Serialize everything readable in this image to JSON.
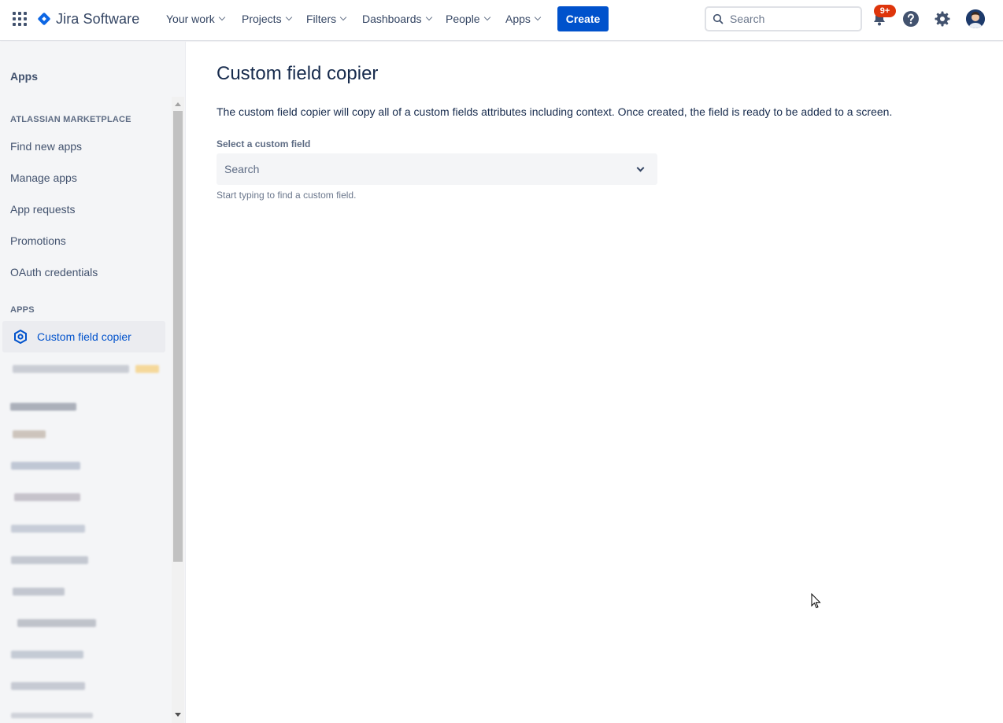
{
  "topnav": {
    "product_name": "Jira Software",
    "items": [
      "Your work",
      "Projects",
      "Filters",
      "Dashboards",
      "People",
      "Apps"
    ],
    "create_label": "Create",
    "search_placeholder": "Search",
    "notification_badge": "9+"
  },
  "sidebar": {
    "header": "Apps",
    "marketplace_section": "ATLASSIAN MARKETPLACE",
    "marketplace_items": [
      "Find new apps",
      "Manage apps",
      "App requests",
      "Promotions",
      "OAuth credentials"
    ],
    "apps_section": "APPS",
    "active_item": "Custom field copier"
  },
  "main": {
    "title": "Custom field copier",
    "description": "The custom field copier will copy all of a custom fields attributes including context. Once created, the field is ready to be added to a screen.",
    "field_label": "Select a custom field",
    "select_placeholder": "Search",
    "helper_text": "Start typing to find a custom field."
  },
  "colors": {
    "brand_blue": "#0052cc",
    "badge_red": "#de350b",
    "sidebar_bg": "#f4f5f7"
  }
}
